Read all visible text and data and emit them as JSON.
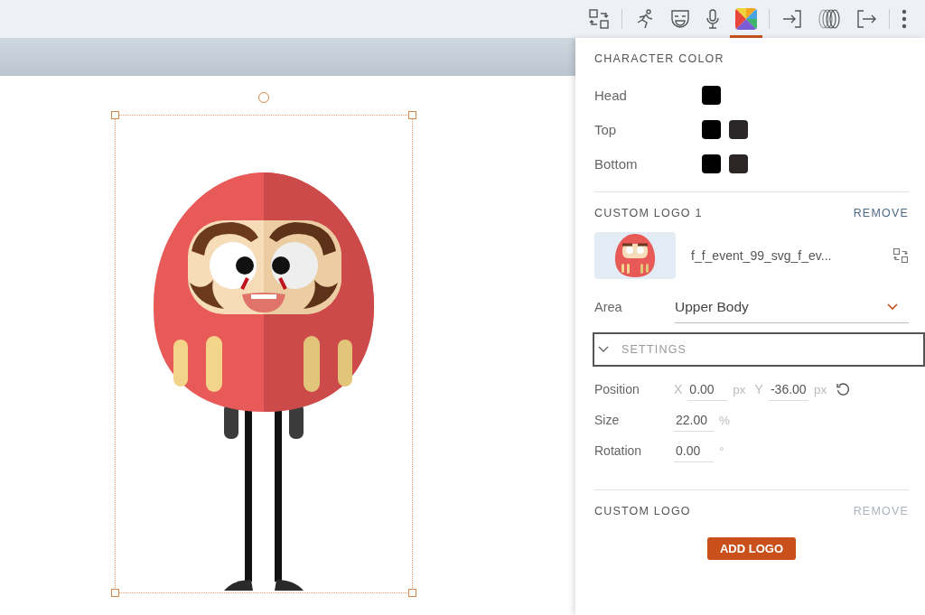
{
  "toolbar": [
    {
      "kind": "swap",
      "selected": false
    },
    {
      "kind": "divider"
    },
    {
      "kind": "run",
      "selected": false
    },
    {
      "kind": "mask",
      "selected": false
    },
    {
      "kind": "mic",
      "selected": false
    },
    {
      "kind": "color",
      "selected": true
    },
    {
      "kind": "divider"
    },
    {
      "kind": "enter",
      "selected": false
    },
    {
      "kind": "rings",
      "selected": false
    },
    {
      "kind": "exit",
      "selected": false
    },
    {
      "kind": "divider"
    },
    {
      "kind": "more",
      "selected": false
    }
  ],
  "character_color": {
    "title": "CHARACTER COLOR",
    "parts": [
      {
        "label": "Head",
        "swatches": [
          {
            "color": "#000000"
          }
        ]
      },
      {
        "label": "Top",
        "swatches": [
          {
            "color": "#000000"
          },
          {
            "color": "#2b2728"
          }
        ]
      },
      {
        "label": "Bottom",
        "swatches": [
          {
            "color": "#000000"
          },
          {
            "color": "#2b2526"
          }
        ]
      }
    ]
  },
  "logos": [
    {
      "title": "CUSTOM LOGO 1",
      "remove": {
        "label": "REMOVE",
        "disabled": false
      },
      "file": "f_f_event_99_svg_f_ev...",
      "area": {
        "label": "Area",
        "value": "Upper Body"
      },
      "settings": {
        "label": "SETTINGS",
        "fields": [
          {
            "label": "Position",
            "inputs": [
              {
                "prefix": "X",
                "value": "0.00",
                "unit": "px"
              },
              {
                "prefix": "Y",
                "value": "-36.00",
                "unit": "px"
              }
            ],
            "reset": true
          },
          {
            "label": "Size",
            "inputs": [
              {
                "value": "22.00",
                "unit": "%"
              }
            ],
            "reset": false
          },
          {
            "label": "Rotation",
            "inputs": [
              {
                "value": "0.00",
                "unit": "°"
              }
            ],
            "reset": false
          }
        ]
      }
    },
    {
      "title": "CUSTOM LOGO",
      "remove": {
        "label": "REMOVE",
        "disabled": true
      },
      "add_button": "ADD LOGO"
    }
  ]
}
